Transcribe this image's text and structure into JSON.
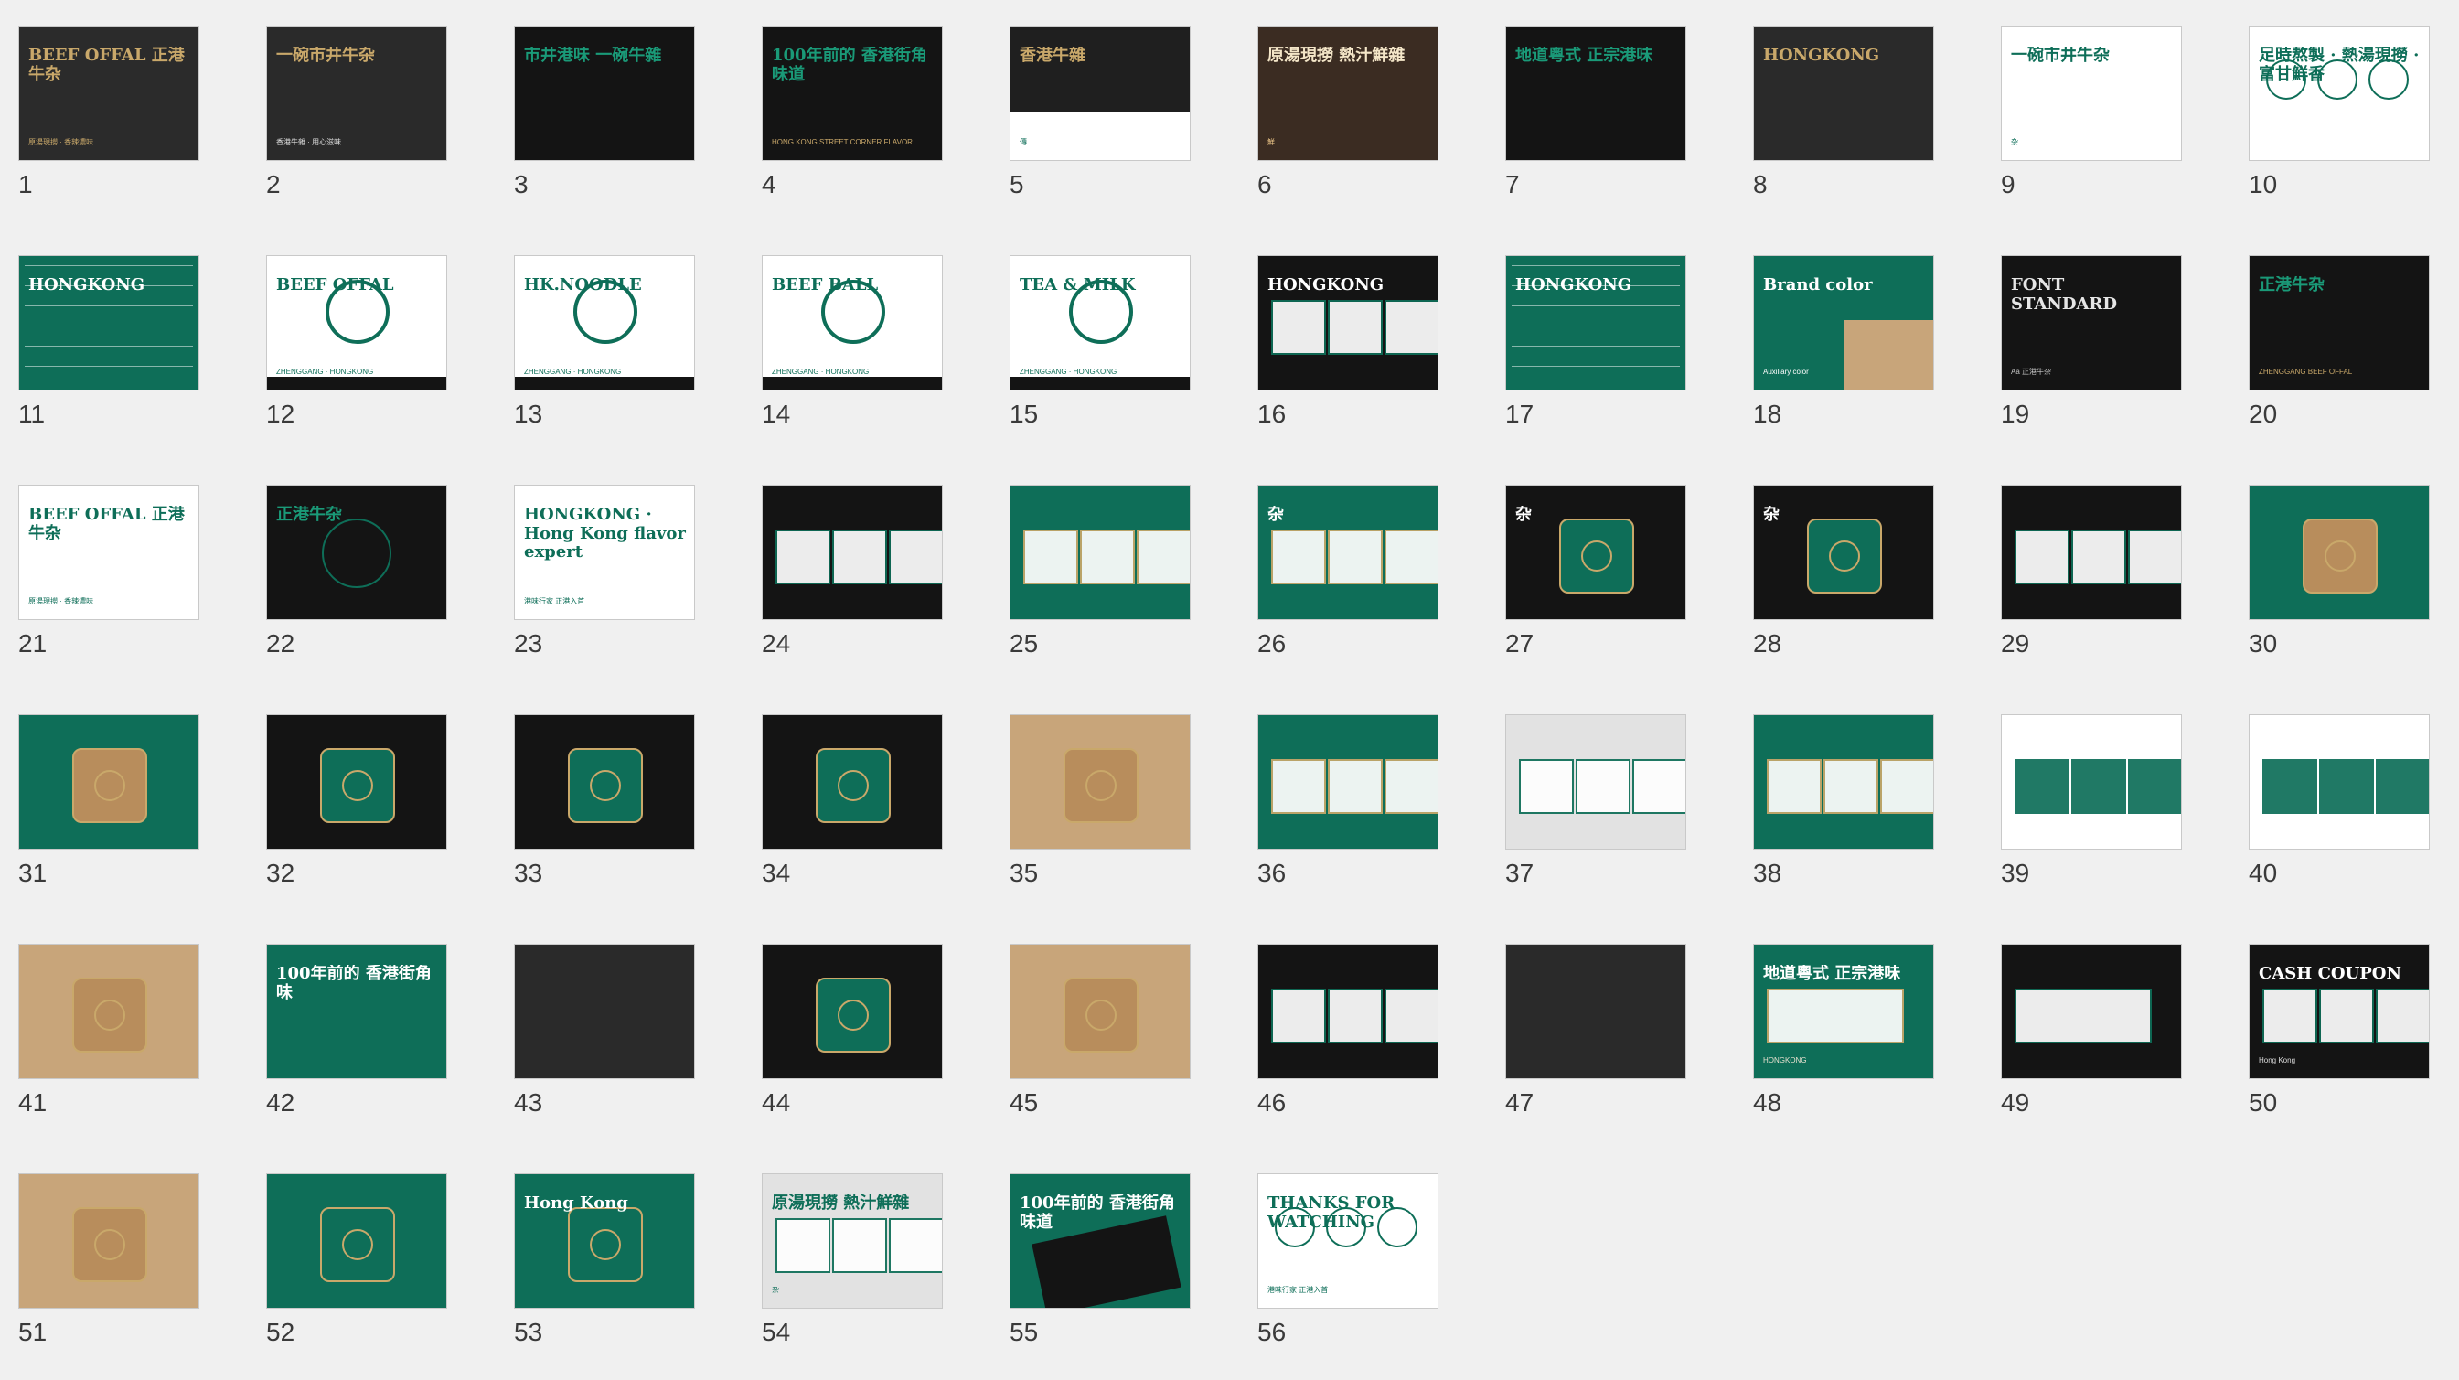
{
  "view": "slide-sorter",
  "colors": {
    "background": "#f0f0f0",
    "number_text": "#3a3a3a",
    "brand_green": "#0e6e58",
    "brand_gold": "#c9a86a",
    "dark": "#141414",
    "white": "#ffffff",
    "kraft": "#c8a57a"
  },
  "slides": [
    {
      "number": "1",
      "theme": "dark-gold",
      "title": "BEEF OFFAL 正港牛杂",
      "subtitle": "原湯現撈 · 香辣濃味"
    },
    {
      "number": "2",
      "theme": "photo-dark",
      "title": "一碗市井牛杂",
      "subtitle": "香港牛雜 · 用心滋味"
    },
    {
      "number": "3",
      "theme": "dark-green",
      "title": "市井港味 一碗牛雜",
      "subtitle": ""
    },
    {
      "number": "4",
      "theme": "dark-green",
      "title": "100年前的 香港街角味道",
      "subtitle": "HONG KONG STREET CORNER FLAVOR"
    },
    {
      "number": "5",
      "theme": "split-dark",
      "title": "香港牛雜",
      "subtitle": "傳"
    },
    {
      "number": "6",
      "theme": "food-dark",
      "title": "原湯現撈 熱汁鮮雜",
      "subtitle": "鮮"
    },
    {
      "number": "7",
      "theme": "black-green",
      "title": "地道粵式 正宗港味",
      "subtitle": ""
    },
    {
      "number": "8",
      "theme": "photo-bw",
      "title": "HONGKONG",
      "subtitle": ""
    },
    {
      "number": "9",
      "theme": "white-black",
      "title": "一碗市井牛杂",
      "subtitle": "杂"
    },
    {
      "number": "10",
      "theme": "white-gold",
      "title": "足時熬製 · 熱湯現撈 · 富甘鮮香",
      "subtitle": ""
    },
    {
      "number": "11",
      "theme": "pattern-green",
      "title": "HONGKONG",
      "subtitle": ""
    },
    {
      "number": "12",
      "theme": "white-badge",
      "title": "BEEF OFFAL",
      "subtitle": "ZHENGGANG · HONGKONG"
    },
    {
      "number": "13",
      "theme": "white-badge",
      "title": "HK.NOODLE",
      "subtitle": "ZHENGGANG · HONGKONG"
    },
    {
      "number": "14",
      "theme": "white-badge",
      "title": "BEEF BALL",
      "subtitle": "ZHENGGANG · HONGKONG"
    },
    {
      "number": "15",
      "theme": "white-badge",
      "title": "TEA & MILK",
      "subtitle": "ZHENGGANG · HONGKONG"
    },
    {
      "number": "16",
      "theme": "black-cards",
      "title": "HONGKONG",
      "subtitle": ""
    },
    {
      "number": "17",
      "theme": "pattern-diag",
      "title": "HONGKONG",
      "subtitle": ""
    },
    {
      "number": "18",
      "theme": "color-spec",
      "title": "Brand color",
      "subtitle": "Auxiliary color"
    },
    {
      "number": "19",
      "theme": "font-spec",
      "title": "FONT STANDARD",
      "subtitle": "Aa 正港牛杂"
    },
    {
      "number": "20",
      "theme": "black-green",
      "title": "正港牛杂",
      "subtitle": "ZHENGGANG BEEF OFFAL"
    },
    {
      "number": "21",
      "theme": "white-green",
      "title": "BEEF OFFAL 正港牛杂",
      "subtitle": "原湯現撈 · 香辣濃味"
    },
    {
      "number": "22",
      "theme": "black-seal",
      "title": "正港牛杂",
      "subtitle": ""
    },
    {
      "number": "23",
      "theme": "white-green",
      "title": "HONGKONG · Hong Kong flavor expert",
      "subtitle": "港味行家 正港入首"
    },
    {
      "number": "24",
      "theme": "black-cards",
      "title": "",
      "subtitle": ""
    },
    {
      "number": "25",
      "theme": "green-mockup",
      "title": "",
      "subtitle": ""
    },
    {
      "number": "26",
      "theme": "green-mockup",
      "title": "杂",
      "subtitle": ""
    },
    {
      "number": "27",
      "theme": "black-bags",
      "title": "杂",
      "subtitle": ""
    },
    {
      "number": "28",
      "theme": "black-mugs",
      "title": "杂",
      "subtitle": ""
    },
    {
      "number": "29",
      "theme": "black-mockup",
      "title": "",
      "subtitle": ""
    },
    {
      "number": "30",
      "theme": "green-kraft",
      "title": "",
      "subtitle": ""
    },
    {
      "number": "31",
      "theme": "green-kraft",
      "title": "",
      "subtitle": ""
    },
    {
      "number": "32",
      "theme": "black-boxes",
      "title": "",
      "subtitle": ""
    },
    {
      "number": "33",
      "theme": "black-menu",
      "title": "",
      "subtitle": ""
    },
    {
      "number": "34",
      "theme": "black-boxes",
      "title": "",
      "subtitle": ""
    },
    {
      "number": "35",
      "theme": "kraft-bag",
      "title": "",
      "subtitle": ""
    },
    {
      "number": "36",
      "theme": "green-cards",
      "title": "",
      "subtitle": ""
    },
    {
      "number": "37",
      "theme": "grey-mockup",
      "title": "",
      "subtitle": ""
    },
    {
      "number": "38",
      "theme": "green-cards",
      "title": "",
      "subtitle": ""
    },
    {
      "number": "39",
      "theme": "white-mockup",
      "title": "",
      "subtitle": ""
    },
    {
      "number": "40",
      "theme": "white-cards",
      "title": "",
      "subtitle": ""
    },
    {
      "number": "41",
      "theme": "kraft-food",
      "title": "",
      "subtitle": ""
    },
    {
      "number": "42",
      "theme": "green-food",
      "title": "100年前的 香港街角味",
      "subtitle": ""
    },
    {
      "number": "43",
      "theme": "photo-street",
      "title": "",
      "subtitle": ""
    },
    {
      "number": "44",
      "theme": "black-apron",
      "title": "",
      "subtitle": ""
    },
    {
      "number": "45",
      "theme": "kraft-apron",
      "title": "",
      "subtitle": ""
    },
    {
      "number": "46",
      "theme": "black-posters",
      "title": "",
      "subtitle": ""
    },
    {
      "number": "47",
      "theme": "photo-poster",
      "title": "",
      "subtitle": ""
    },
    {
      "number": "48",
      "theme": "green-billboard",
      "title": "地道粵式 正宗港味",
      "subtitle": "HONGKONG"
    },
    {
      "number": "49",
      "theme": "black-billboard",
      "title": "",
      "subtitle": ""
    },
    {
      "number": "50",
      "theme": "black-coupon",
      "title": "CASH COUPON",
      "subtitle": "Hong Kong"
    },
    {
      "number": "51",
      "theme": "kraft-stand",
      "title": "",
      "subtitle": ""
    },
    {
      "number": "52",
      "theme": "green-stand",
      "title": "",
      "subtitle": ""
    },
    {
      "number": "53",
      "theme": "green-pack",
      "title": "Hong Kong",
      "subtitle": ""
    },
    {
      "number": "54",
      "theme": "grey-posters",
      "title": "原湯現撈 熱汁鮮雜",
      "subtitle": "杂"
    },
    {
      "number": "55",
      "theme": "green-black",
      "title": "100年前的 香港街角味道",
      "subtitle": ""
    },
    {
      "number": "56",
      "theme": "white-end",
      "title": "THANKS FOR WATCHING",
      "subtitle": "港味行家 正港入首"
    }
  ]
}
